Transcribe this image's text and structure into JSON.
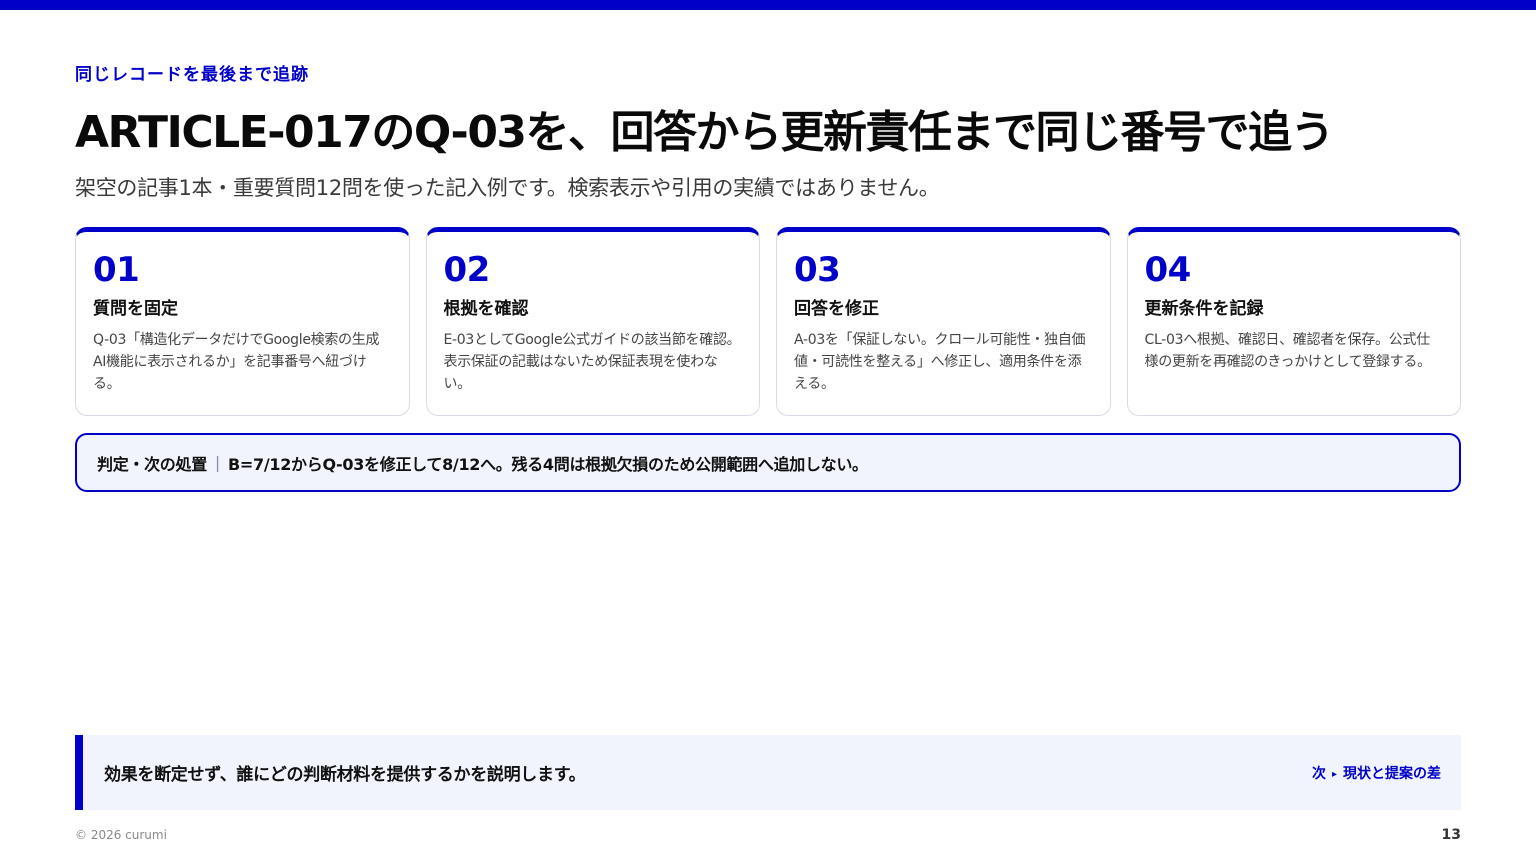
{
  "slide": {
    "eyebrow": "同じレコードを最後まで追跡",
    "title": "ARTICLE-017のQ-03を、回答から更新責任まで同じ番号で追う",
    "subtitle": "架空の記事1本・重要質問12問を使った記入例です。検索表示や引用の実績ではありません。"
  },
  "steps": [
    {
      "number": "01",
      "title": "質問を固定",
      "body": "Q-03「構造化データだけでGoogle検索の生成AI機能に表示されるか」を記事番号へ紐づける。"
    },
    {
      "number": "02",
      "title": "根拠を確認",
      "body": "E-03としてGoogle公式ガイドの該当節を確認。表示保証の記載はないため保証表現を使わない。"
    },
    {
      "number": "03",
      "title": "回答を修正",
      "body": "A-03を「保証しない。クロール可能性・独自価値・可読性を整える」へ修正し、適用条件を添える。"
    },
    {
      "number": "04",
      "title": "更新条件を記録",
      "body": "CL-03へ根拠、確認日、確認者を保存。公式仕様の更新を再確認のきっかけとして登録する。"
    }
  ],
  "verdict": {
    "label": "判定・次の処置",
    "separator": "|",
    "text": "B=7/12からQ-03を修正して8/12へ。残る4問は根拠欠損のため公開範囲へ追加しない。"
  },
  "footer_note": {
    "text": "効果を断定せず、誰にどの判断材料を提供するかを説明します。",
    "next_prefix": "次",
    "next_arrow": "▸",
    "next_label": "現状と提案の差"
  },
  "footer": {
    "copyright": "© 2026 curumi",
    "page_number": "13"
  },
  "colors": {
    "accent": "#0000c8",
    "panel_background": "#f1f4fd",
    "card_border": "#d9dbe6"
  }
}
